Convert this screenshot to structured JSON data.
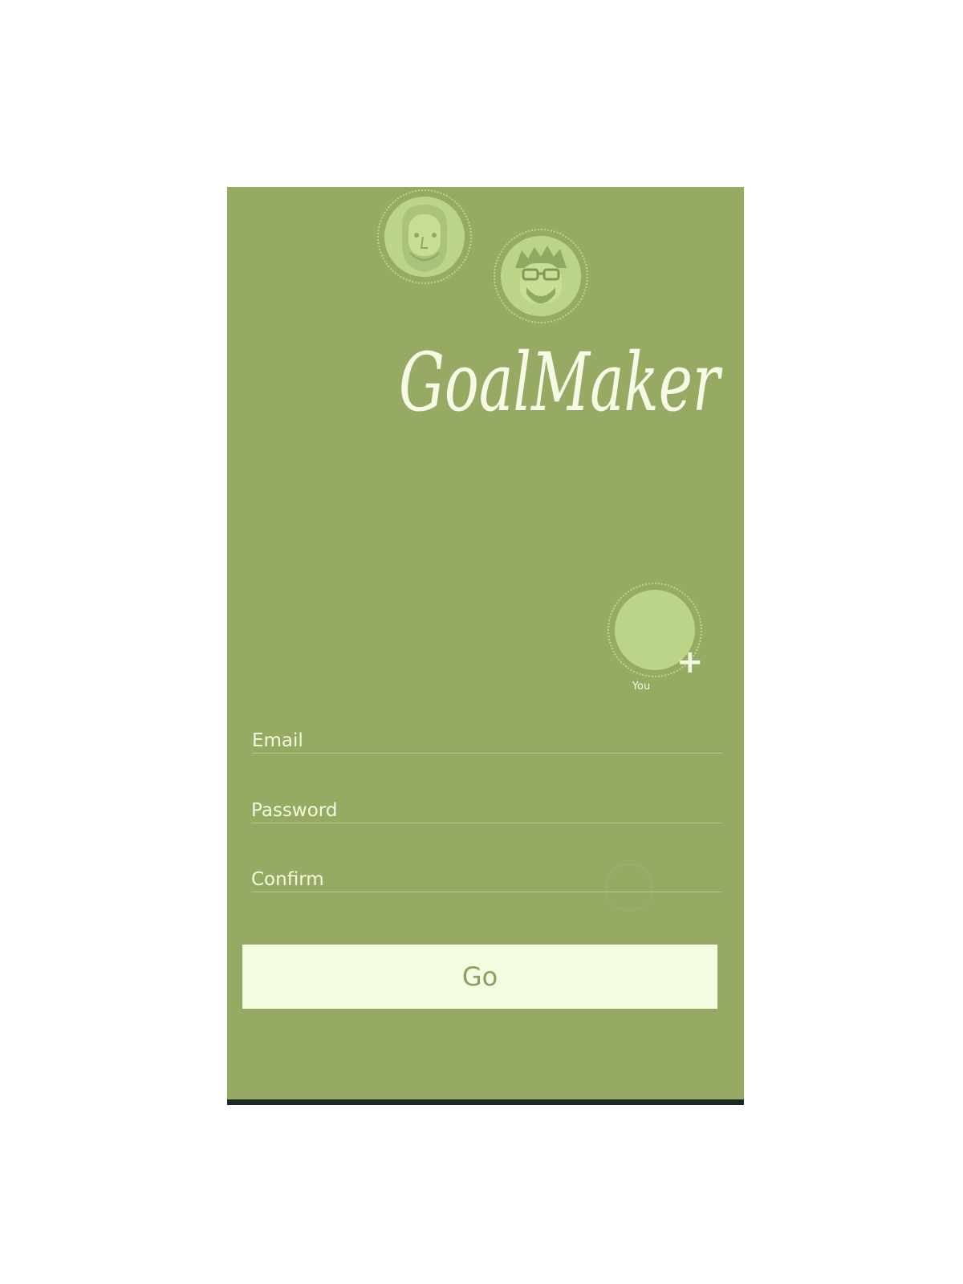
{
  "app": {
    "logo_text": "GoalMaker"
  },
  "avatars": [
    {
      "name": "bearded-man",
      "icon": "bearded-man-avatar-icon"
    },
    {
      "name": "glasses-man",
      "icon": "glasses-man-avatar-icon"
    }
  ],
  "you_avatar": {
    "label": "You",
    "add_icon": "plus-icon"
  },
  "form": {
    "email": {
      "placeholder": "Email",
      "value": ""
    },
    "password": {
      "placeholder": "Password",
      "value": ""
    },
    "confirm": {
      "placeholder": "Confirm",
      "value": ""
    },
    "submit_label": "Go"
  },
  "colors": {
    "background": "#96aa64",
    "accent_light": "#bcd488",
    "text_light": "#f2fae0",
    "button_bg": "#f3fbe0",
    "button_text": "#8d9f5f"
  }
}
